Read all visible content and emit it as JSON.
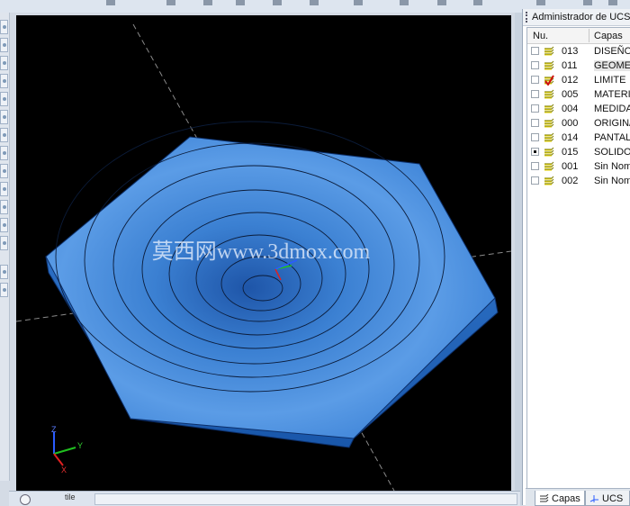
{
  "layers_panel": {
    "title": "Administrador de UCS",
    "col_number": "Nu.",
    "col_name": "Capas",
    "rows": [
      {
        "number": "013",
        "name": "DISEÑO",
        "checked": false,
        "current": false
      },
      {
        "number": "011",
        "name": "GEOME",
        "checked": false,
        "current": false
      },
      {
        "number": "012",
        "name": "LIMITE",
        "checked": false,
        "current": true
      },
      {
        "number": "005",
        "name": "MATERI",
        "checked": false,
        "current": false
      },
      {
        "number": "004",
        "name": "MEDIDA",
        "checked": false,
        "current": false
      },
      {
        "number": "000",
        "name": "ORIGIN/",
        "checked": false,
        "current": false
      },
      {
        "number": "014",
        "name": "PANTAL",
        "checked": false,
        "current": false
      },
      {
        "number": "015",
        "name": "SOLIDO",
        "checked": true,
        "current": false
      },
      {
        "number": "001",
        "name": "Sin Nom",
        "checked": false,
        "current": false
      },
      {
        "number": "002",
        "name": "Sin Nom",
        "checked": false,
        "current": false
      }
    ],
    "tabs": [
      "Capas",
      "UCS"
    ]
  },
  "viewport": {
    "watermark": "莫西网www.3dmox.com",
    "axis_labels": {
      "x": "X",
      "y": "Y",
      "z": "Z"
    },
    "colors": {
      "background": "#000000",
      "part_top": "#3a7fd0",
      "part_side": "#1d5fb2",
      "axis_x": "#e02020",
      "axis_y": "#20c020",
      "axis_z": "#2a5cff"
    }
  },
  "statusbar": {
    "text": "tile"
  }
}
